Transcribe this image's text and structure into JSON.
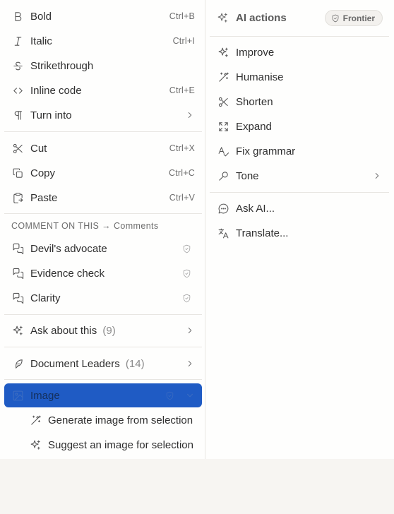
{
  "format": {
    "bold": {
      "label": "Bold",
      "shortcut": "Ctrl+B",
      "icon": "bold-icon"
    },
    "italic": {
      "label": "Italic",
      "shortcut": "Ctrl+I",
      "icon": "italic-icon"
    },
    "strikethrough": {
      "label": "Strikethrough",
      "icon": "strikethrough-icon"
    },
    "inline_code": {
      "label": "Inline code",
      "shortcut": "Ctrl+E",
      "icon": "code-icon"
    },
    "turn_into": {
      "label": "Turn into",
      "icon": "pilcrow-icon"
    }
  },
  "clipboard": {
    "cut": {
      "label": "Cut",
      "shortcut": "Ctrl+X",
      "icon": "scissors-icon"
    },
    "copy": {
      "label": "Copy",
      "shortcut": "Ctrl+C",
      "icon": "copy-icon"
    },
    "paste": {
      "label": "Paste",
      "shortcut": "Ctrl+V",
      "icon": "paste-icon"
    }
  },
  "comment": {
    "section_label": "COMMENT ON THIS → Comments",
    "items": [
      {
        "label": "Devil's advocate"
      },
      {
        "label": "Evidence check"
      },
      {
        "label": "Clarity"
      }
    ]
  },
  "ask": {
    "label": "Ask about this",
    "count": "(9)"
  },
  "leaders": {
    "label": "Document Leaders",
    "count": "(14)"
  },
  "image": {
    "label": "Image",
    "sub": [
      {
        "label": "Generate image from selection"
      },
      {
        "label": "Suggest an image for selection"
      }
    ]
  },
  "ai": {
    "title": "AI actions",
    "badge": "Frontier",
    "items": [
      {
        "label": "Improve"
      },
      {
        "label": "Humanise"
      },
      {
        "label": "Shorten"
      },
      {
        "label": "Expand"
      },
      {
        "label": "Fix grammar"
      },
      {
        "label": "Tone"
      }
    ],
    "more": [
      {
        "label": "Ask AI..."
      },
      {
        "label": "Translate..."
      }
    ]
  },
  "colors": {
    "active_bg": "#1f5bc4",
    "menu_bg": "#fefefd",
    "page_bg": "#f7f5f2"
  }
}
